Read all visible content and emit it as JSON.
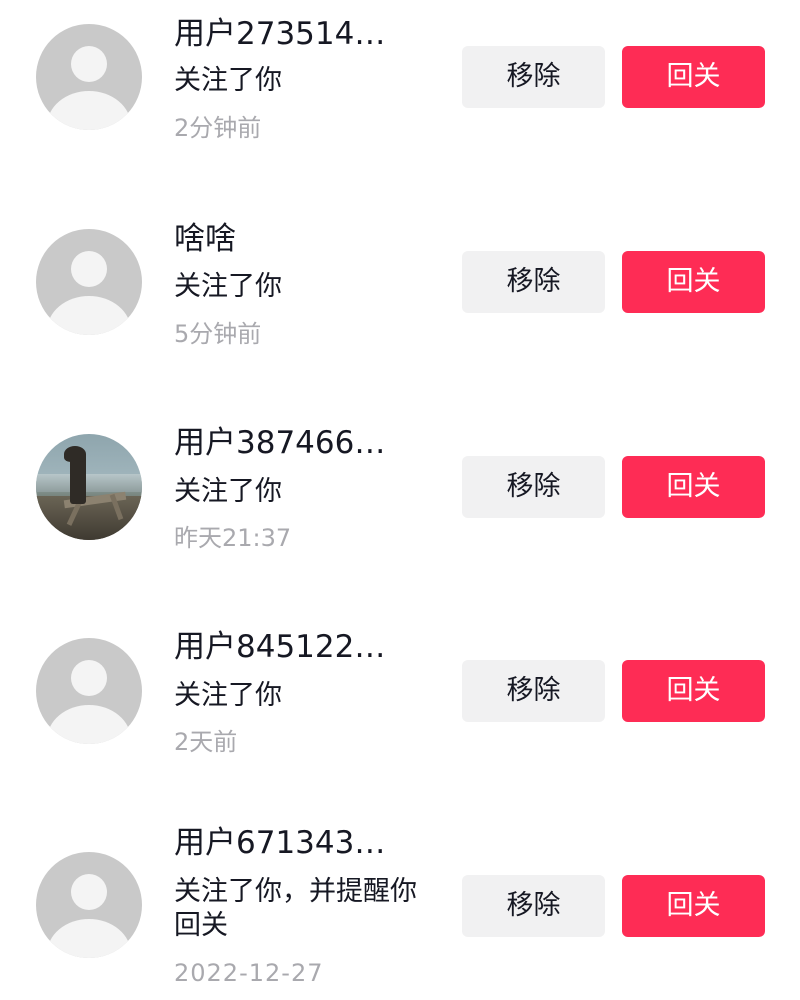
{
  "followers": [
    {
      "name": "用户273514…",
      "action": "关注了你",
      "time": "2分钟前",
      "avatar": "default-avatar",
      "remove_label": "移除",
      "follow_back_label": "回关"
    },
    {
      "name": "啥啥",
      "action": "关注了你",
      "time": "5分钟前",
      "avatar": "default-avatar",
      "remove_label": "移除",
      "follow_back_label": "回关"
    },
    {
      "name": "用户387466…",
      "action": "关注了你",
      "time": "昨天21:37",
      "avatar": "photo-avatar",
      "remove_label": "移除",
      "follow_back_label": "回关"
    },
    {
      "name": "用户845122…",
      "action": "关注了你",
      "time": "2天前",
      "avatar": "default-avatar",
      "remove_label": "移除",
      "follow_back_label": "回关"
    },
    {
      "name": "用户671343…",
      "action": "关注了你，并提醒你回关",
      "time": "2022-12-27",
      "avatar": "default-avatar",
      "remove_label": "移除",
      "follow_back_label": "回关"
    }
  ],
  "colors": {
    "follow_back_bg": "#fe2c55",
    "remove_bg": "#f1f1f2",
    "primary_text": "#161823",
    "secondary_text": "#a9a9ae"
  }
}
